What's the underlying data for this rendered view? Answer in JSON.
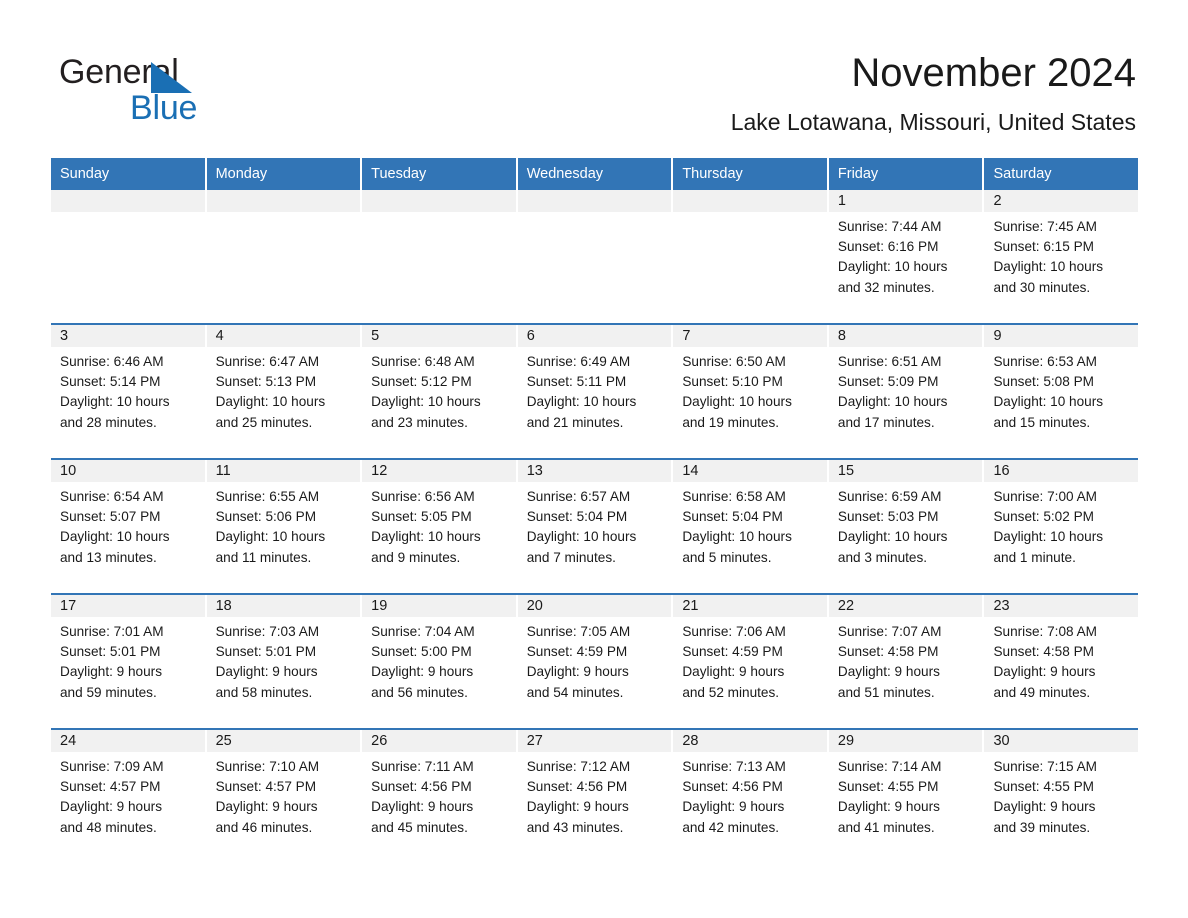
{
  "logo": {
    "line1": "General",
    "line2": "Blue",
    "triangle_color": "#1a6fb4",
    "text_color": "#231f20"
  },
  "header": {
    "month_title": "November 2024",
    "location": "Lake Lotawana, Missouri, United States"
  },
  "theme": {
    "header_blue": "#3275b6",
    "day_band_gray": "#f1f1f1",
    "text": "#1a1a1a"
  },
  "weekdays": [
    "Sunday",
    "Monday",
    "Tuesday",
    "Wednesday",
    "Thursday",
    "Friday",
    "Saturday"
  ],
  "weeks": [
    [
      {
        "day": "",
        "l1": "",
        "l2": "",
        "l3": "",
        "l4": ""
      },
      {
        "day": "",
        "l1": "",
        "l2": "",
        "l3": "",
        "l4": ""
      },
      {
        "day": "",
        "l1": "",
        "l2": "",
        "l3": "",
        "l4": ""
      },
      {
        "day": "",
        "l1": "",
        "l2": "",
        "l3": "",
        "l4": ""
      },
      {
        "day": "",
        "l1": "",
        "l2": "",
        "l3": "",
        "l4": ""
      },
      {
        "day": "1",
        "l1": "Sunrise: 7:44 AM",
        "l2": "Sunset: 6:16 PM",
        "l3": "Daylight: 10 hours",
        "l4": "and 32 minutes."
      },
      {
        "day": "2",
        "l1": "Sunrise: 7:45 AM",
        "l2": "Sunset: 6:15 PM",
        "l3": "Daylight: 10 hours",
        "l4": "and 30 minutes."
      }
    ],
    [
      {
        "day": "3",
        "l1": "Sunrise: 6:46 AM",
        "l2": "Sunset: 5:14 PM",
        "l3": "Daylight: 10 hours",
        "l4": "and 28 minutes."
      },
      {
        "day": "4",
        "l1": "Sunrise: 6:47 AM",
        "l2": "Sunset: 5:13 PM",
        "l3": "Daylight: 10 hours",
        "l4": "and 25 minutes."
      },
      {
        "day": "5",
        "l1": "Sunrise: 6:48 AM",
        "l2": "Sunset: 5:12 PM",
        "l3": "Daylight: 10 hours",
        "l4": "and 23 minutes."
      },
      {
        "day": "6",
        "l1": "Sunrise: 6:49 AM",
        "l2": "Sunset: 5:11 PM",
        "l3": "Daylight: 10 hours",
        "l4": "and 21 minutes."
      },
      {
        "day": "7",
        "l1": "Sunrise: 6:50 AM",
        "l2": "Sunset: 5:10 PM",
        "l3": "Daylight: 10 hours",
        "l4": "and 19 minutes."
      },
      {
        "day": "8",
        "l1": "Sunrise: 6:51 AM",
        "l2": "Sunset: 5:09 PM",
        "l3": "Daylight: 10 hours",
        "l4": "and 17 minutes."
      },
      {
        "day": "9",
        "l1": "Sunrise: 6:53 AM",
        "l2": "Sunset: 5:08 PM",
        "l3": "Daylight: 10 hours",
        "l4": "and 15 minutes."
      }
    ],
    [
      {
        "day": "10",
        "l1": "Sunrise: 6:54 AM",
        "l2": "Sunset: 5:07 PM",
        "l3": "Daylight: 10 hours",
        "l4": "and 13 minutes."
      },
      {
        "day": "11",
        "l1": "Sunrise: 6:55 AM",
        "l2": "Sunset: 5:06 PM",
        "l3": "Daylight: 10 hours",
        "l4": "and 11 minutes."
      },
      {
        "day": "12",
        "l1": "Sunrise: 6:56 AM",
        "l2": "Sunset: 5:05 PM",
        "l3": "Daylight: 10 hours",
        "l4": "and 9 minutes."
      },
      {
        "day": "13",
        "l1": "Sunrise: 6:57 AM",
        "l2": "Sunset: 5:04 PM",
        "l3": "Daylight: 10 hours",
        "l4": "and 7 minutes."
      },
      {
        "day": "14",
        "l1": "Sunrise: 6:58 AM",
        "l2": "Sunset: 5:04 PM",
        "l3": "Daylight: 10 hours",
        "l4": "and 5 minutes."
      },
      {
        "day": "15",
        "l1": "Sunrise: 6:59 AM",
        "l2": "Sunset: 5:03 PM",
        "l3": "Daylight: 10 hours",
        "l4": "and 3 minutes."
      },
      {
        "day": "16",
        "l1": "Sunrise: 7:00 AM",
        "l2": "Sunset: 5:02 PM",
        "l3": "Daylight: 10 hours",
        "l4": "and 1 minute."
      }
    ],
    [
      {
        "day": "17",
        "l1": "Sunrise: 7:01 AM",
        "l2": "Sunset: 5:01 PM",
        "l3": "Daylight: 9 hours",
        "l4": "and 59 minutes."
      },
      {
        "day": "18",
        "l1": "Sunrise: 7:03 AM",
        "l2": "Sunset: 5:01 PM",
        "l3": "Daylight: 9 hours",
        "l4": "and 58 minutes."
      },
      {
        "day": "19",
        "l1": "Sunrise: 7:04 AM",
        "l2": "Sunset: 5:00 PM",
        "l3": "Daylight: 9 hours",
        "l4": "and 56 minutes."
      },
      {
        "day": "20",
        "l1": "Sunrise: 7:05 AM",
        "l2": "Sunset: 4:59 PM",
        "l3": "Daylight: 9 hours",
        "l4": "and 54 minutes."
      },
      {
        "day": "21",
        "l1": "Sunrise: 7:06 AM",
        "l2": "Sunset: 4:59 PM",
        "l3": "Daylight: 9 hours",
        "l4": "and 52 minutes."
      },
      {
        "day": "22",
        "l1": "Sunrise: 7:07 AM",
        "l2": "Sunset: 4:58 PM",
        "l3": "Daylight: 9 hours",
        "l4": "and 51 minutes."
      },
      {
        "day": "23",
        "l1": "Sunrise: 7:08 AM",
        "l2": "Sunset: 4:58 PM",
        "l3": "Daylight: 9 hours",
        "l4": "and 49 minutes."
      }
    ],
    [
      {
        "day": "24",
        "l1": "Sunrise: 7:09 AM",
        "l2": "Sunset: 4:57 PM",
        "l3": "Daylight: 9 hours",
        "l4": "and 48 minutes."
      },
      {
        "day": "25",
        "l1": "Sunrise: 7:10 AM",
        "l2": "Sunset: 4:57 PM",
        "l3": "Daylight: 9 hours",
        "l4": "and 46 minutes."
      },
      {
        "day": "26",
        "l1": "Sunrise: 7:11 AM",
        "l2": "Sunset: 4:56 PM",
        "l3": "Daylight: 9 hours",
        "l4": "and 45 minutes."
      },
      {
        "day": "27",
        "l1": "Sunrise: 7:12 AM",
        "l2": "Sunset: 4:56 PM",
        "l3": "Daylight: 9 hours",
        "l4": "and 43 minutes."
      },
      {
        "day": "28",
        "l1": "Sunrise: 7:13 AM",
        "l2": "Sunset: 4:56 PM",
        "l3": "Daylight: 9 hours",
        "l4": "and 42 minutes."
      },
      {
        "day": "29",
        "l1": "Sunrise: 7:14 AM",
        "l2": "Sunset: 4:55 PM",
        "l3": "Daylight: 9 hours",
        "l4": "and 41 minutes."
      },
      {
        "day": "30",
        "l1": "Sunrise: 7:15 AM",
        "l2": "Sunset: 4:55 PM",
        "l3": "Daylight: 9 hours",
        "l4": "and 39 minutes."
      }
    ]
  ]
}
